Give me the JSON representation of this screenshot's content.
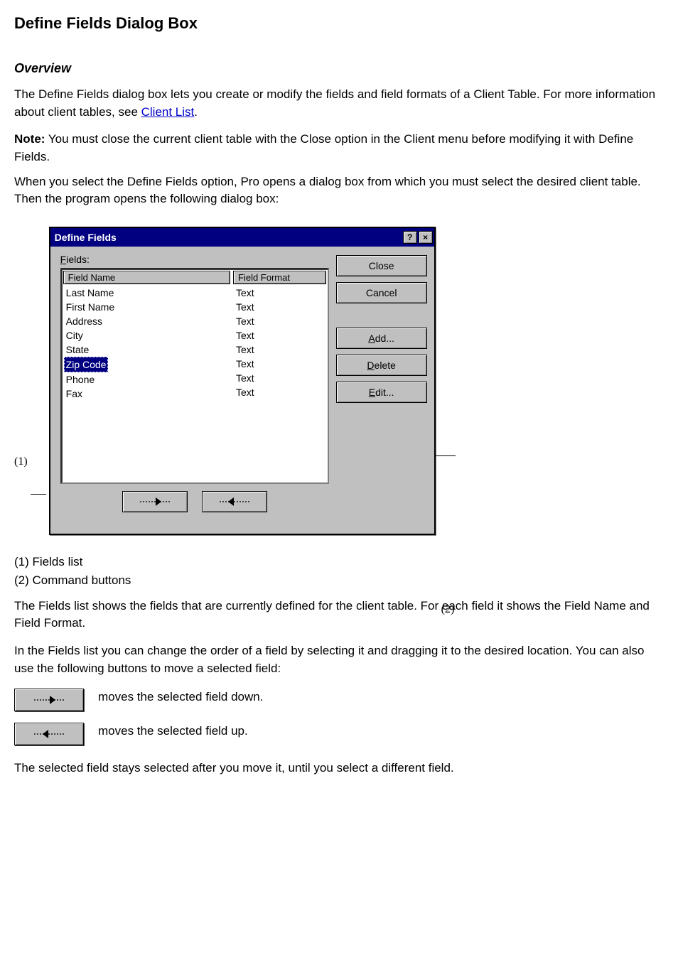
{
  "section": {
    "heading": "Define Fields Dialog Box",
    "subheading": "Overview",
    "intro_pre": "The Define Fields dialog box lets you create or modify the fields and field formats of a Client Table. For more information about client tables, see ",
    "intro_link": "Client List",
    "intro_post": ".",
    "note_label": "Note:",
    "note_text": " You must close the current client table with the Close option in the Client menu before modifying it with Define Fields.",
    "para3": "When you select the Define Fields option, Pro opens a dialog box from which you must select the desired client table. Then the program opens the following dialog box:"
  },
  "dialog": {
    "title": "Define Fields",
    "fields_label_pre": "F",
    "fields_label_post": "ields:",
    "header_name": "Field Name",
    "header_format": "Field Format",
    "rows": [
      {
        "name": "Last Name",
        "format": "Text"
      },
      {
        "name": "First Name",
        "format": "Text"
      },
      {
        "name": "Address",
        "format": "Text"
      },
      {
        "name": "City",
        "format": "Text"
      },
      {
        "name": "State",
        "format": "Text"
      },
      {
        "name": "Zip Code",
        "format": "Text",
        "selected": true
      },
      {
        "name": "Phone",
        "format": "Text"
      },
      {
        "name": "Fax",
        "format": "Text"
      }
    ],
    "buttons": {
      "close": "Close",
      "cancel": "Cancel",
      "add": "Add...",
      "add_u": "A",
      "delete": "Delete",
      "delete_u": "D",
      "edit": "Edit...",
      "edit_u": "E"
    }
  },
  "callouts": {
    "left": "(1)",
    "right": "(2)"
  },
  "legend": {
    "row1": "(1) Fields list",
    "row2": "(2) Command buttons",
    "para": "The Fields list shows the fields that are currently defined for the client table. For each field it shows the Field Name and Field Format.",
    "drag": "In the Fields list you can change the order of a field by selecting it and dragging it to the desired location. You can also use the following buttons to move a selected field:",
    "btn_down": "moves the selected field down.",
    "btn_up": "moves the selected field up.",
    "final": "The selected field stays selected after you move it, until you select a different field."
  }
}
